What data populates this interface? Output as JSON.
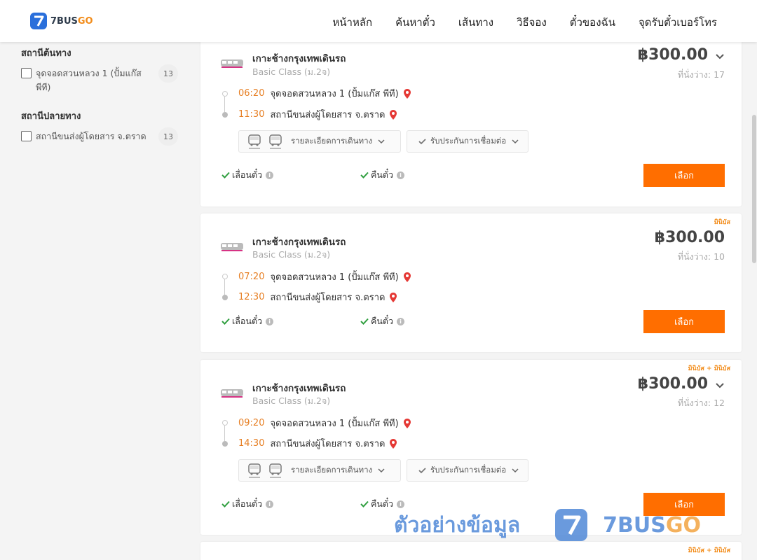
{
  "header": {
    "logo_text": "7BUS",
    "logo_text_accent": "GO",
    "nav": [
      "หน้าหลัก",
      "ค้นหาตั๋ว",
      "เส้นทาง",
      "วิธีจอง",
      "ตั๋วของฉัน",
      "จุดรับตั๋วเบอร์โทร"
    ]
  },
  "sidebar": {
    "origin": {
      "title": "สถานีต้นทาง",
      "option": "จุดจอดสวนหลวง 1 (ปั้มแก๊ส พีที)",
      "count": "13"
    },
    "destination": {
      "title": "สถานีปลายทาง",
      "option": "สถานีขนส่งผู้โดยสาร จ.ตราด",
      "count": "13"
    }
  },
  "trips": [
    {
      "tag": "",
      "operator": "เกาะช้างกรุงเทพเดินรถ",
      "class": "Basic Class (ม.2จ)",
      "price": "฿300.00",
      "seats": "ที่นั่งว่าง: 17",
      "depart_time": "06:20",
      "depart_place": "จุดจอดสวนหลวง 1 (ปั้มแก๊ส พีที)",
      "arrive_time": "11:30",
      "arrive_place": "สถานีขนส่งผู้โดยสาร จ.ตราด",
      "detail_label": "รายละเอียดการเดินทาง",
      "insurance_label": "รับประกันการเชื่อมต่อ",
      "change_label": "เลื่อนตั๋ว",
      "refund_label": "คืนตั๋ว",
      "select_label": "เลือก"
    },
    {
      "tag": "มินิบัส",
      "operator": "เกาะช้างกรุงเทพเดินรถ",
      "class": "Basic Class (ม.2จ)",
      "price": "฿300.00",
      "seats": "ที่นั่งว่าง: 10",
      "depart_time": "07:20",
      "depart_place": "จุดจอดสวนหลวง 1 (ปั้มแก๊ส พีที)",
      "arrive_time": "12:30",
      "arrive_place": "สถานีขนส่งผู้โดยสาร จ.ตราด",
      "change_label": "เลื่อนตั๋ว",
      "refund_label": "คืนตั๋ว",
      "select_label": "เลือก"
    },
    {
      "tag": "มินิบัส + มินิบัส",
      "operator": "เกาะช้างกรุงเทพเดินรถ",
      "class": "Basic Class (ม.2จ)",
      "price": "฿300.00",
      "seats": "ที่นั่งว่าง: 12",
      "depart_time": "09:20",
      "depart_place": "จุดจอดสวนหลวง 1 (ปั้มแก๊ส พีที)",
      "arrive_time": "14:30",
      "arrive_place": "สถานีขนส่งผู้โดยสาร จ.ตราด",
      "detail_label": "รายละเอียดการเดินทาง",
      "insurance_label": "รับประกันการเชื่อมต่อ",
      "change_label": "เลื่อนตั๋ว",
      "refund_label": "คืนตั๋ว",
      "select_label": "เลือก"
    },
    {
      "tag": "มินิบัส + มินิบัส"
    }
  ],
  "watermark": {
    "thai_text": "ตัวอย่างข้อมูล",
    "brand": "7BUS",
    "brand_accent": "GO"
  },
  "colors": {
    "accent_orange": "#ff6e00",
    "time_orange": "#e67e22",
    "brand_blue": "#2a6fdb",
    "pin_red": "#e53935",
    "check_green": "#2e9e3e"
  }
}
